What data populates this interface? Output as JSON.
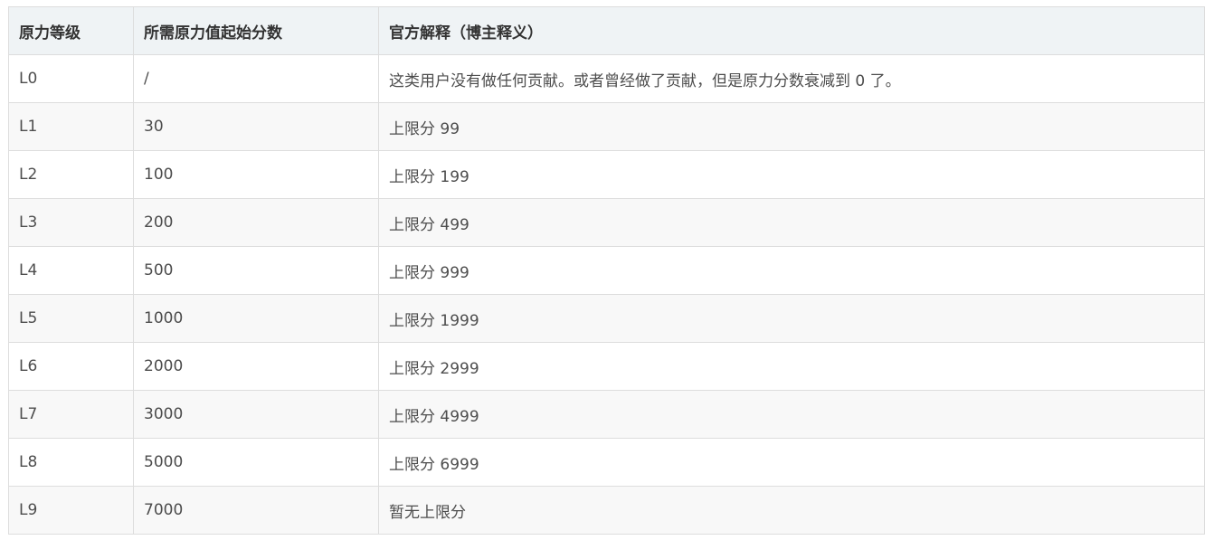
{
  "table": {
    "headers": [
      "原力等级",
      "所需原力值起始分数",
      "官方解释（博主释义）"
    ],
    "rows": [
      [
        "L0",
        "/",
        "这类用户没有做任何贡献。或者曾经做了贡献，但是原力分数衰减到 0 了。"
      ],
      [
        "L1",
        "30",
        "上限分 99"
      ],
      [
        "L2",
        "100",
        "上限分 199"
      ],
      [
        "L3",
        "200",
        "上限分 499"
      ],
      [
        "L4",
        "500",
        "上限分 999"
      ],
      [
        "L5",
        "1000",
        "上限分 1999"
      ],
      [
        "L6",
        "2000",
        "上限分 2999"
      ],
      [
        "L7",
        "3000",
        "上限分 4999"
      ],
      [
        "L8",
        "5000",
        "上限分 6999"
      ],
      [
        "L9",
        "7000",
        "暂无上限分"
      ]
    ]
  }
}
